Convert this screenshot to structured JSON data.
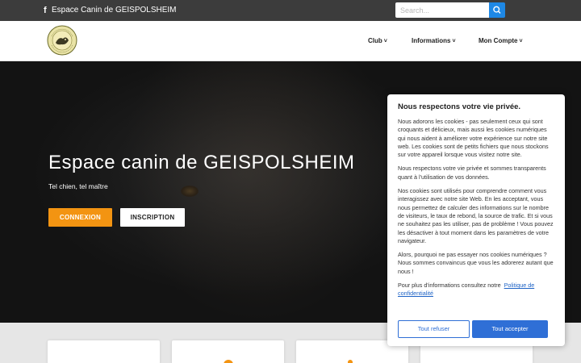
{
  "topbar": {
    "facebook_icon": "facebook-icon",
    "site_name": "Espace Canin de GEISPOLSHEIM",
    "search_placeholder": "Search...",
    "search_icon": "search-icon"
  },
  "navbar": {
    "logo_alt": "logo",
    "items": [
      {
        "label": "Club",
        "caret": "˅"
      },
      {
        "label": "Informations",
        "caret": "˅"
      },
      {
        "label": "Mon Compte",
        "caret": "˅"
      }
    ]
  },
  "hero": {
    "title": "Espace canin de GEISPOLSHEIM",
    "tagline": "Tel chien, tel maître",
    "btn_connexion": "CONNEXION",
    "btn_inscription": "INSCRIPTION"
  },
  "cookie": {
    "title": "Nous respectons votre vie privée.",
    "p1": "Nous adorons les cookies - pas seulement ceux qui sont croquants et délicieux, mais aussi les cookies numériques qui nous aident à améliorer votre expérience sur notre site web. Les cookies sont de petits fichiers que nous stockons sur votre appareil lorsque vous visitez notre site.",
    "p2": "Nous respectons votre vie privée et sommes transparents quant à l'utilisation de vos données.",
    "p3": "Nos cookies sont utilisés pour comprendre comment vous interagissez avec notre site Web. En les acceptant, vous nous permettez de calculer des informations sur le nombre de visiteurs, le taux de rebond, la source de trafic. Et si vous ne souhaitez pas les utiliser, pas de problème ! Vous pouvez les désactiver à tout moment dans les paramètres de votre navigateur.",
    "p4": "Alors, pourquoi ne pas essayer nos cookies numériques ? Nous sommes convaincus que vous les adorerez autant que nous !",
    "more_prefix": "Pour plus d'informations consultez notre",
    "policy_link": "Politique de confidentialité",
    "refuse": "Tout refuser",
    "accept": "Tout accepter"
  },
  "colors": {
    "accent_orange": "#f39412",
    "primary_blue": "#2f6fd6",
    "topbar_bg": "#3c3c3c"
  }
}
